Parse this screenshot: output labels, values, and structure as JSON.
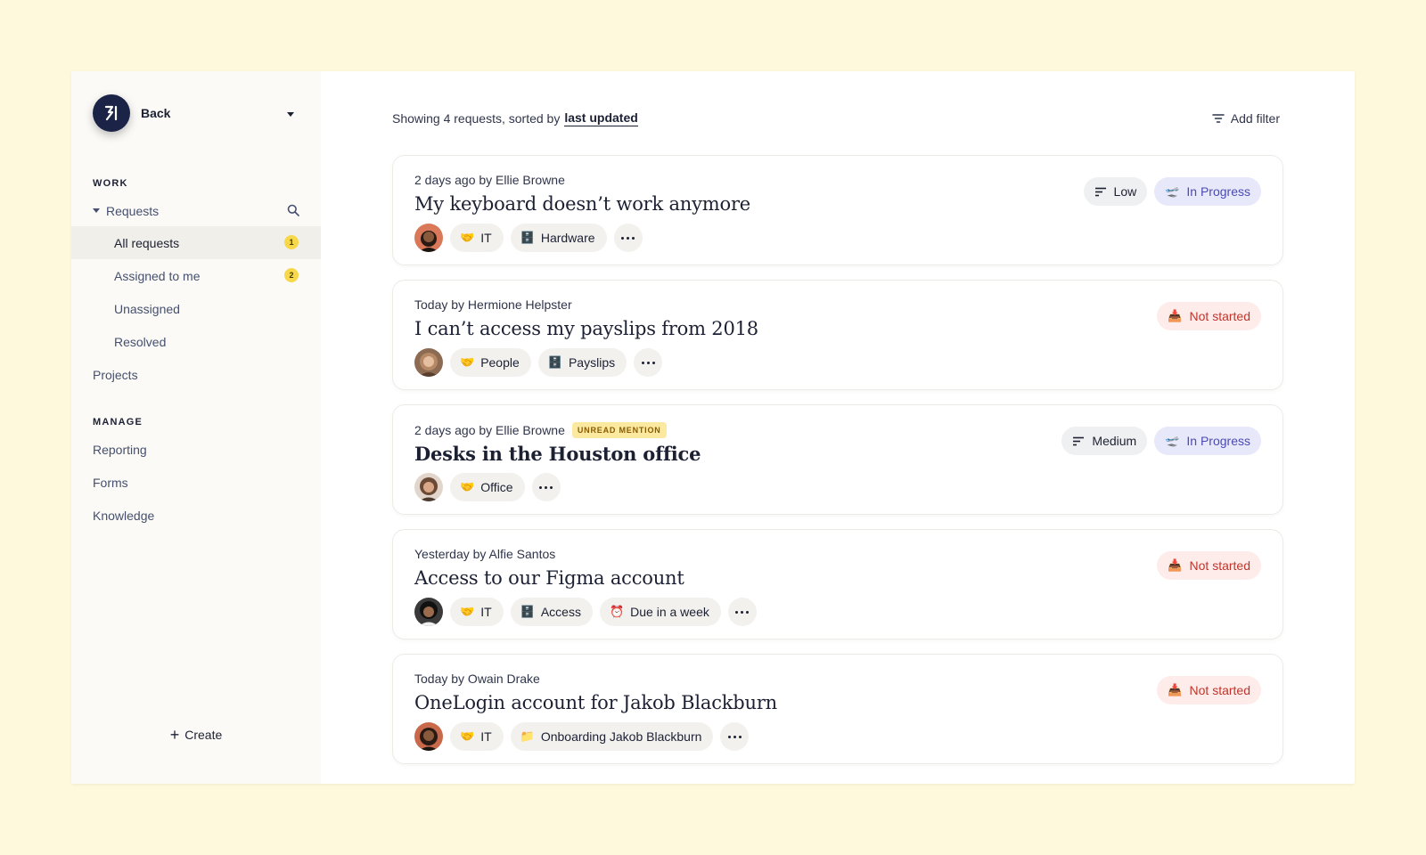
{
  "sidebar": {
    "brand": {
      "name": "Back"
    },
    "sections": {
      "work": "WORK",
      "manage": "MANAGE"
    },
    "requests_label": "Requests",
    "sub_items": [
      {
        "label": "All requests",
        "count": "1"
      },
      {
        "label": "Assigned to me",
        "count": "2"
      },
      {
        "label": "Unassigned"
      },
      {
        "label": "Resolved"
      }
    ],
    "projects_label": "Projects",
    "manage_items": [
      {
        "label": "Reporting"
      },
      {
        "label": "Forms"
      },
      {
        "label": "Knowledge"
      }
    ],
    "create_label": "Create"
  },
  "toolbar": {
    "summary": "Showing 4 requests, sorted by",
    "sort_field": "last updated",
    "add_filter": "Add filter"
  },
  "requests": [
    {
      "meta": "2 days ago by Ellie Browne",
      "title": "My keyboard doesn’t work anymore",
      "tags": [
        {
          "emoji": "🤝",
          "label": "IT"
        },
        {
          "emoji": "🗄️",
          "label": "Hardware"
        }
      ],
      "priority": "Low",
      "status": "In Progress"
    },
    {
      "meta": "Today by Hermione Helpster",
      "title": "I can’t access my payslips from 2018",
      "tags": [
        {
          "emoji": "🤝",
          "label": "People"
        },
        {
          "emoji": "🗄️",
          "label": "Payslips"
        }
      ],
      "status": "Not started"
    },
    {
      "meta": "2 days ago by Ellie Browne",
      "mention": "UNREAD MENTION",
      "title": "Desks in the Houston office",
      "tags": [
        {
          "emoji": "🤝",
          "label": "Office"
        }
      ],
      "priority": "Medium",
      "status": "In Progress"
    },
    {
      "meta": "Yesterday by Alfie Santos",
      "title": "Access to our Figma account",
      "tags": [
        {
          "emoji": "🤝",
          "label": "IT"
        },
        {
          "emoji": "🗄️",
          "label": "Access"
        },
        {
          "emoji": "⏰",
          "label": "Due in a week"
        }
      ],
      "status": "Not started"
    },
    {
      "meta": "Today by Owain Drake",
      "title": "OneLogin account for Jakob Blackburn",
      "tags": [
        {
          "emoji": "🤝",
          "label": "IT"
        },
        {
          "emoji": "📁",
          "label": "Onboarding Jakob Blackburn"
        }
      ],
      "status": "Not started"
    }
  ],
  "colors": {
    "page_background": "#fef8dc",
    "sidebar_background": "#fbfaf7",
    "brand_logo": "#1b2446",
    "badge": "#f6d84a",
    "in_progress": "#4b4bb3",
    "not_started": "#c0352b",
    "mention": "#fbe9a0"
  },
  "icons": {
    "search": "search-icon",
    "filter": "filter-icon",
    "priority": "priority-bars-icon",
    "in_progress": "airplane-icon",
    "not_started": "inbox-tray-icon",
    "more": "ellipsis-icon"
  }
}
